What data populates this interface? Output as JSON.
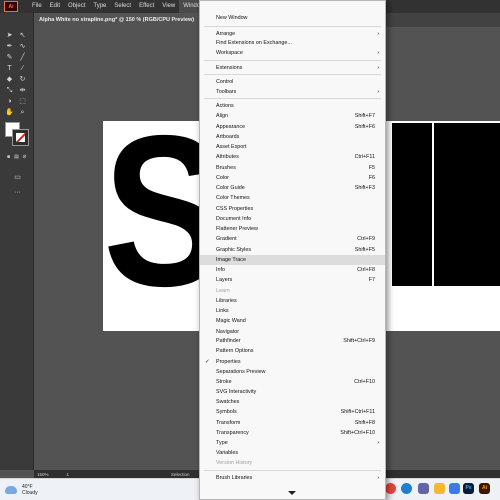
{
  "app": {
    "logo_text": "Ai"
  },
  "menubar": {
    "items": [
      "File",
      "Edit",
      "Object",
      "Type",
      "Select",
      "Effect",
      "View",
      "Window"
    ],
    "active": "Window"
  },
  "document": {
    "tab_title": "Alpha White no strapline.png* @ 150 % (RGB/CPU Preview)",
    "close_glyph": "×"
  },
  "tools": [
    "selection-tool-icon",
    "direct-selection-tool-icon",
    "pen-tool-icon",
    "curvature-tool-icon",
    "pencil-tool-icon",
    "paintbrush-tool-icon",
    "type-tool-icon",
    "line-tool-icon",
    "eraser-tool-icon",
    "rotate-tool-icon",
    "scale-tool-icon",
    "width-tool-icon",
    "shape-builder-tool-icon",
    "free-transform-tool-icon",
    "hand-tool-icon",
    "zoom-tool-icon",
    "more-tools-icon"
  ],
  "statusbar": {
    "zoom": "150%",
    "page": "1",
    "tool": "Selection"
  },
  "taskbar": {
    "temperature": "40°F",
    "condition": "Cloudy",
    "apps": [
      {
        "name": "chrome",
        "color": "#e8453c"
      },
      {
        "name": "edge",
        "color": "#1f7fd1"
      },
      {
        "name": "teams",
        "color": "#6264a7"
      },
      {
        "name": "explorer",
        "color": "#f2b92b"
      },
      {
        "name": "store",
        "color": "#3b7be6"
      },
      {
        "name": "photoshop",
        "label": "Ps",
        "color": "#0c1b35"
      },
      {
        "name": "illustrator",
        "label": "Ai",
        "color": "#3a1500"
      }
    ]
  },
  "window_menu": {
    "items": [
      {
        "label": "New Window"
      },
      {
        "label": "Arrange",
        "submenu": true
      },
      {
        "label": "Find Extensions on Exchange..."
      },
      {
        "label": "Workspace",
        "submenu": true
      },
      {
        "label": "Extensions",
        "submenu": true
      },
      {
        "label": "Control"
      },
      {
        "label": "Toolbars",
        "submenu": true
      },
      {
        "label": "Actions"
      },
      {
        "label": "Align",
        "shortcut": "Shift+F7"
      },
      {
        "label": "Appearance",
        "shortcut": "Shift+F6"
      },
      {
        "label": "Artboards"
      },
      {
        "label": "Asset Export"
      },
      {
        "label": "Attributes",
        "shortcut": "Ctrl+F11"
      },
      {
        "label": "Brushes",
        "shortcut": "F5"
      },
      {
        "label": "Color",
        "shortcut": "F6"
      },
      {
        "label": "Color Guide",
        "shortcut": "Shift+F3"
      },
      {
        "label": "Color Themes"
      },
      {
        "label": "CSS Properties"
      },
      {
        "label": "Document Info"
      },
      {
        "label": "Flattener Preview"
      },
      {
        "label": "Gradient",
        "shortcut": "Ctrl+F9"
      },
      {
        "label": "Graphic Styles",
        "shortcut": "Shift+F5"
      },
      {
        "label": "Image Trace",
        "highlighted": true
      },
      {
        "label": "Info",
        "shortcut": "Ctrl+F8"
      },
      {
        "label": "Layers",
        "shortcut": "F7"
      },
      {
        "label": "Learn",
        "disabled": true
      },
      {
        "label": "Libraries"
      },
      {
        "label": "Links"
      },
      {
        "label": "Magic Wand"
      },
      {
        "label": "Navigator"
      },
      {
        "label": "Pathfinder",
        "shortcut": "Shift+Ctrl+F9"
      },
      {
        "label": "Pattern Options"
      },
      {
        "label": "Properties",
        "checked": true
      },
      {
        "label": "Separations Preview"
      },
      {
        "label": "Stroke",
        "shortcut": "Ctrl+F10"
      },
      {
        "label": "SVG Interactivity"
      },
      {
        "label": "Swatches"
      },
      {
        "label": "Symbols",
        "shortcut": "Shift+Ctrl+F11"
      },
      {
        "label": "Transform",
        "shortcut": "Shift+F8"
      },
      {
        "label": "Transparency",
        "shortcut": "Shift+Ctrl+F10"
      },
      {
        "label": "Type",
        "submenu": true
      },
      {
        "label": "Variables"
      },
      {
        "label": "Version History",
        "disabled": true
      },
      {
        "label": "Brush Libraries",
        "submenu": true
      }
    ],
    "check_glyph": "✓",
    "submenu_glyph": "›"
  }
}
